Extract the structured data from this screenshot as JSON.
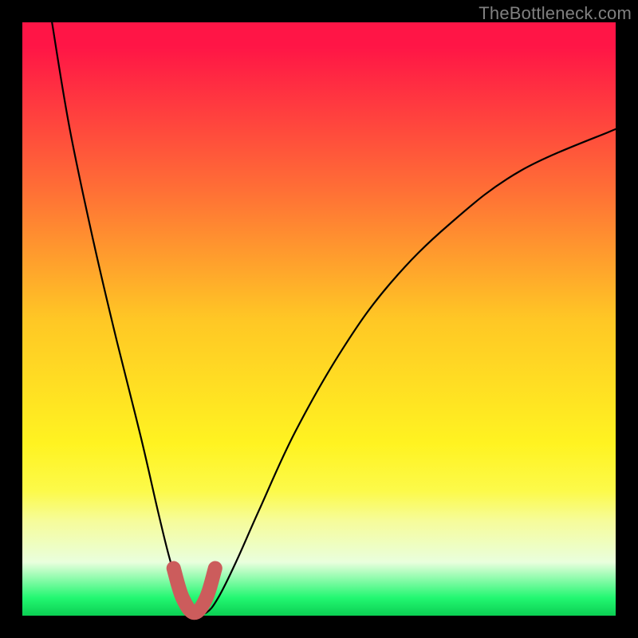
{
  "watermark": "TheBottleneck.com",
  "colors": {
    "background_frame": "#000000",
    "gradient_top": "#ff1546",
    "gradient_mid1": "#ff6e36",
    "gradient_mid2": "#ffc725",
    "gradient_mid3": "#fff321",
    "gradient_mid4": "#fcfa4a",
    "gradient_mid5": "#f6fc9a",
    "gradient_mid6": "#e9ffdd",
    "gradient_bottom1": "#22f771",
    "gradient_bottom2": "#0ccf53",
    "curve": "#000000",
    "highlight": "#cc5c5c"
  },
  "chart_data": {
    "type": "line",
    "title": "",
    "xlabel": "",
    "ylabel": "",
    "xlim": [
      0,
      100
    ],
    "ylim": [
      0,
      100
    ],
    "grid": false,
    "legend": false,
    "series": [
      {
        "name": "bottleneck-curve",
        "x": [
          5,
          8,
          12,
          16,
          20,
          23,
          25,
          27,
          29,
          31,
          33,
          36,
          40,
          46,
          54,
          62,
          72,
          84,
          100
        ],
        "y": [
          100,
          82,
          63,
          46,
          30,
          17,
          9,
          3,
          0.5,
          0.5,
          3,
          9,
          18,
          31,
          45,
          56,
          66,
          75,
          82
        ]
      },
      {
        "name": "optimal-range-highlight",
        "x": [
          25.5,
          27,
          29,
          31,
          32.5
        ],
        "y": [
          8,
          3,
          0.5,
          3,
          8
        ]
      }
    ]
  }
}
